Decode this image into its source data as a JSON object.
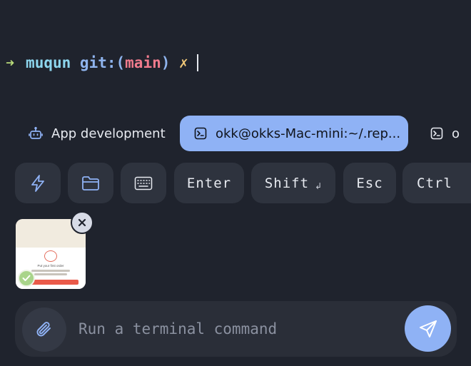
{
  "terminal": {
    "prompt_arrow": "➜",
    "user": "muqun",
    "git_label": "git:",
    "paren_open": "(",
    "branch": "main",
    "paren_close": ")",
    "dirty_mark": "✗"
  },
  "tabs": [
    {
      "label": "App development",
      "icon": "robot-icon",
      "active": false
    },
    {
      "label": "okk@okks-Mac-mini:~/.rep...",
      "icon": "terminal-icon",
      "active": true
    },
    {
      "label": "o",
      "icon": "terminal-icon",
      "active": false
    }
  ],
  "keys": [
    {
      "icon": "lightning-icon"
    },
    {
      "icon": "folder-icon"
    },
    {
      "icon": "keyboard-icon"
    },
    {
      "label": "Enter"
    },
    {
      "label": "Shift",
      "sub": "↲"
    },
    {
      "label": "Esc"
    },
    {
      "label": "Ctrl"
    }
  ],
  "attachment": {
    "title": "Put your first order",
    "status": "check-icon",
    "remove": "close-icon"
  },
  "input": {
    "placeholder": "Run a terminal command",
    "value": ""
  },
  "colors": {
    "background": "#1f232d",
    "accent": "#8fb2f5",
    "key_bg": "#2e333e",
    "branch": "#f07b8d",
    "user": "#8dd6ee",
    "dirty": "#f0c878",
    "arrow": "#b9db7a"
  }
}
